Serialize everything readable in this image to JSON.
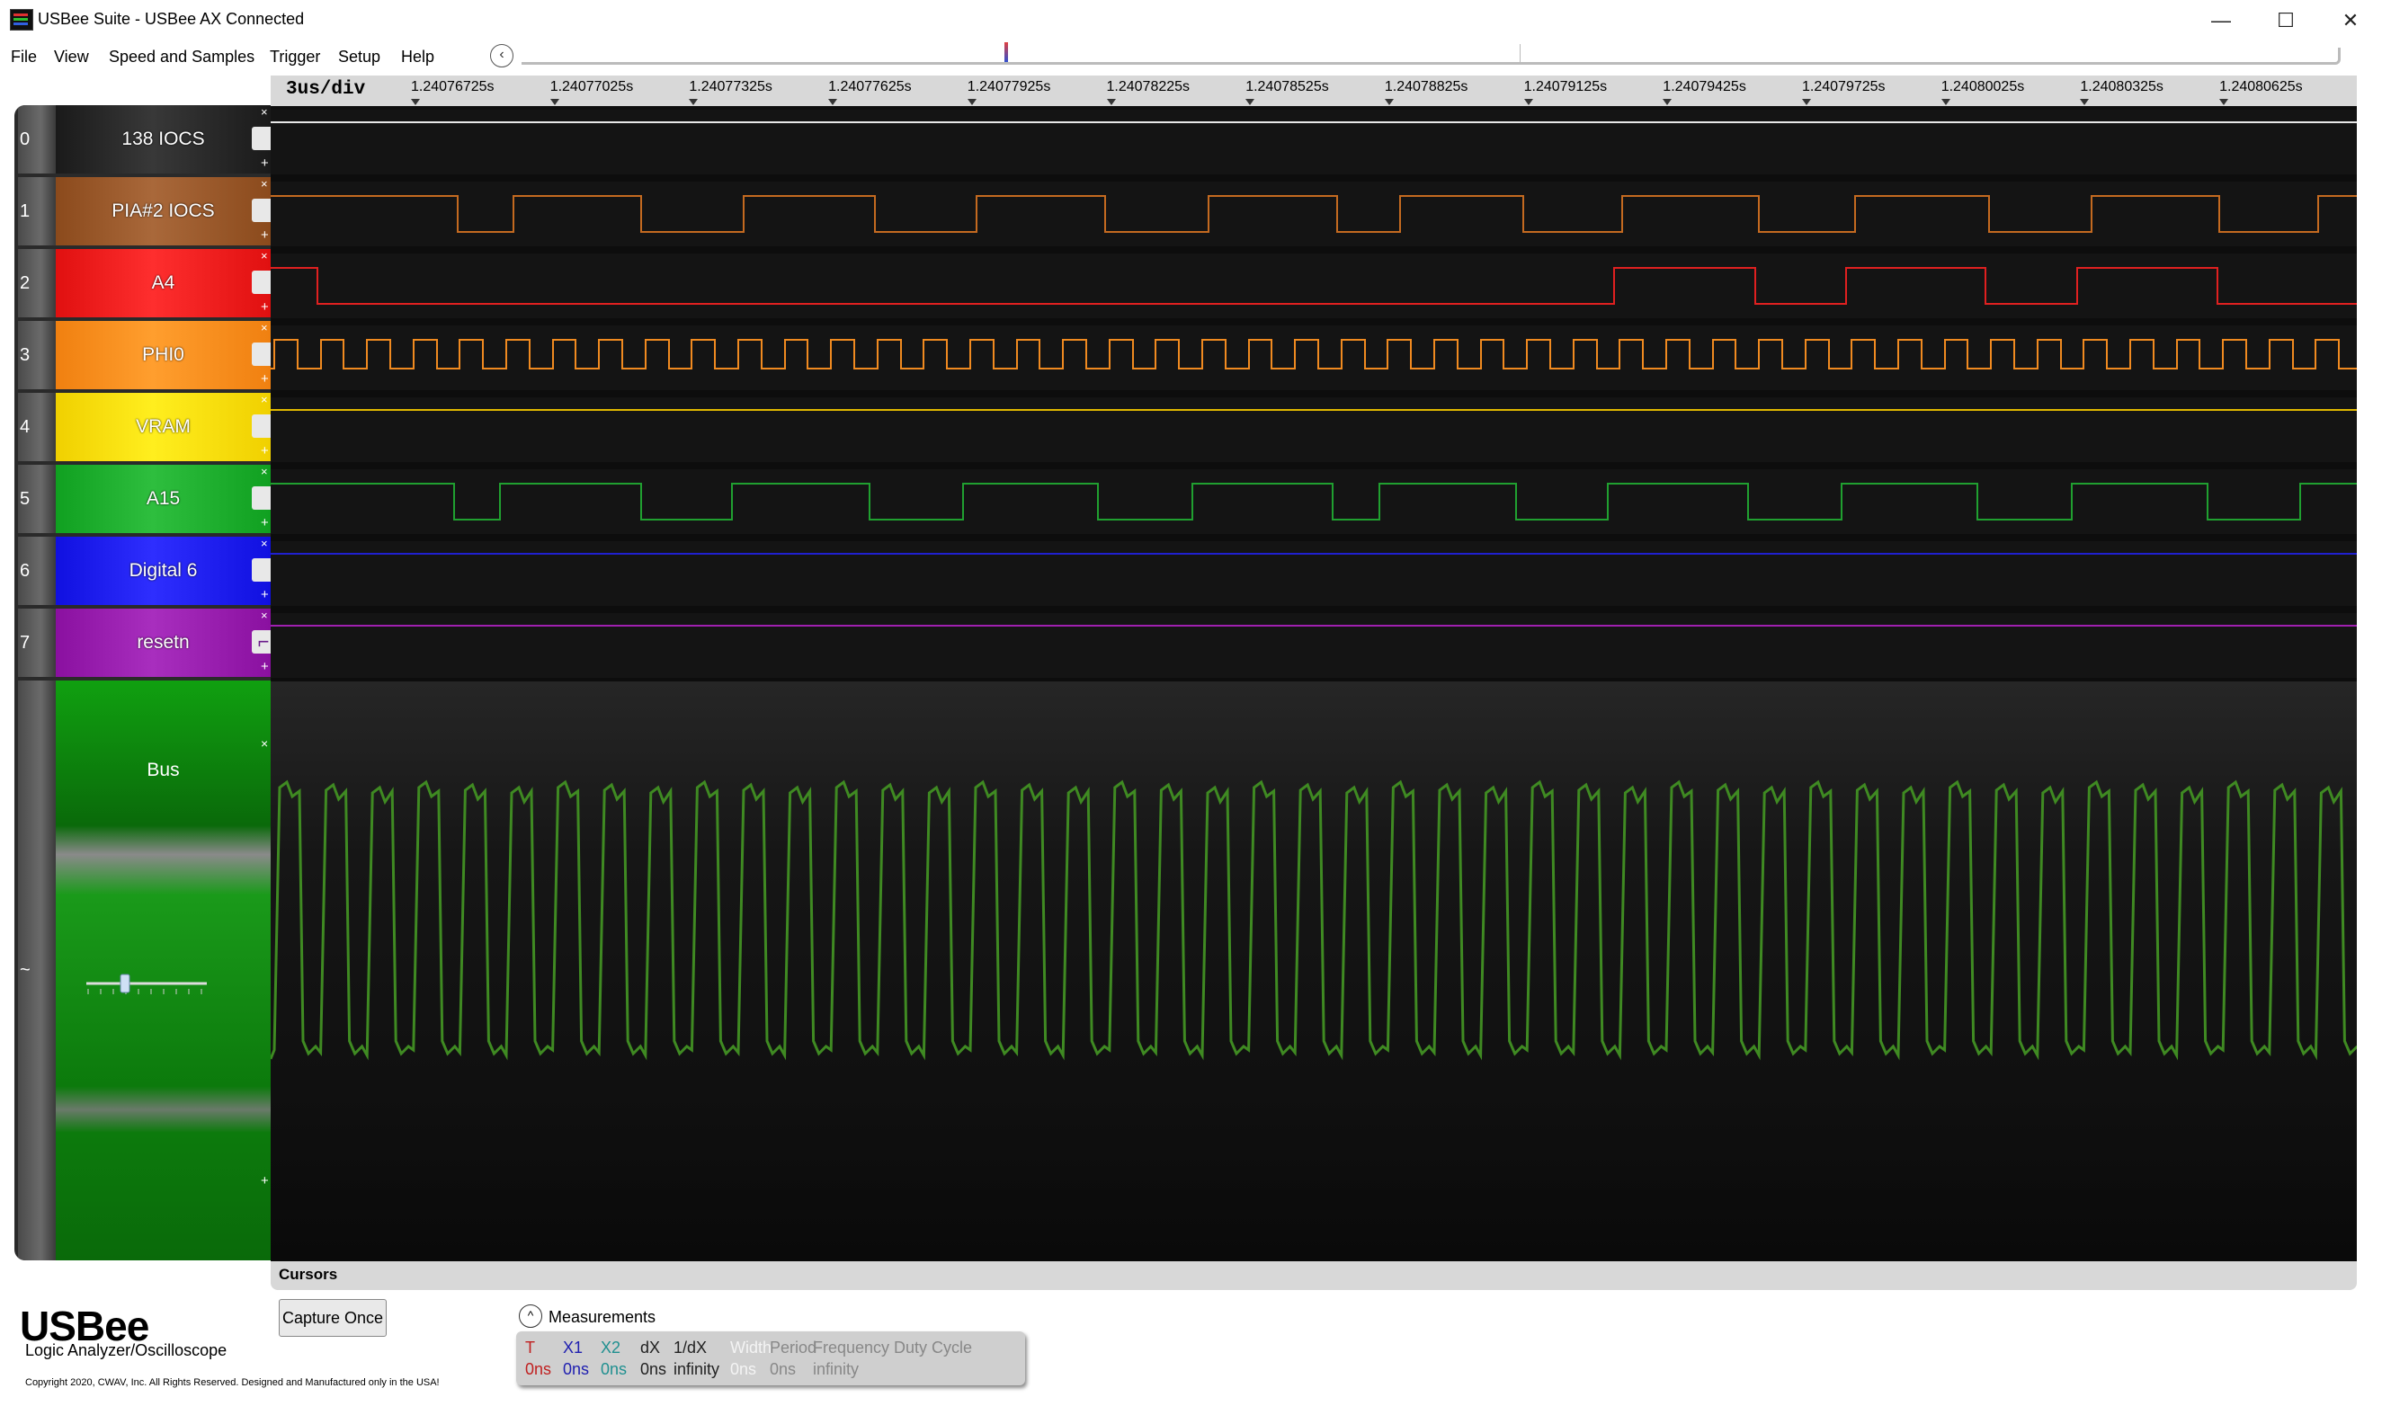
{
  "window": {
    "title": "USBee Suite - USBee AX Connected",
    "controls": [
      "—",
      "☐",
      "✕"
    ]
  },
  "menu": [
    "File",
    "View",
    "Speed and Samples",
    "Trigger",
    "Setup",
    "Help"
  ],
  "toolbar": {
    "scroll_back_icon": "chevron-left-icon"
  },
  "ruler": {
    "scale": "3us/div",
    "ticks": [
      "1.24076725s",
      "1.24077025s",
      "1.24077325s",
      "1.24077625s",
      "1.24077925s",
      "1.24078225s",
      "1.24078525s",
      "1.24078825s",
      "1.24079125s",
      "1.24079425s",
      "1.24079725s",
      "1.24080025s",
      "1.24080325s",
      "1.24080625s"
    ]
  },
  "channels": [
    {
      "num": "0",
      "name": "138 IOCS",
      "color": "#1a1a1a"
    },
    {
      "num": "1",
      "name": "PIA#2 IOCS",
      "color": "#8b4a1c"
    },
    {
      "num": "2",
      "name": "A4",
      "color": "#e01010"
    },
    {
      "num": "3",
      "name": "PHI0",
      "color": "#f08010"
    },
    {
      "num": "4",
      "name": "VRAM",
      "color": "#f0d000"
    },
    {
      "num": "5",
      "name": "A15",
      "color": "#10a020"
    },
    {
      "num": "6",
      "name": "Digital 6",
      "color": "#1010e0"
    },
    {
      "num": "7",
      "name": "resetn",
      "color": "#8a10a0",
      "trigger_glyph": "⌐"
    }
  ],
  "bus": {
    "name": "Bus",
    "num": "~",
    "color": "#129212"
  },
  "channel_controls": {
    "remove": "×",
    "add": "+"
  },
  "bottom": {
    "cursors_label": "Cursors",
    "logo": "USBee",
    "logo_sub": "Logic Analyzer/Oscilloscope",
    "copyright": "Copyright 2020, CWAV, Inc. All Rights Reserved. Designed and Manufactured only in the USA!",
    "capture_button": "Capture Once",
    "measurements_label": "Measurements",
    "measurements_toggle": "^",
    "measurements": [
      {
        "label": "T",
        "value": "0ns",
        "color": "#c02020"
      },
      {
        "label": "X1",
        "value": "0ns",
        "color": "#2020b0"
      },
      {
        "label": "X2",
        "value": "0ns",
        "color": "#209090"
      },
      {
        "label": "dX",
        "value": "0ns",
        "color": "#222222"
      },
      {
        "label": "1/dX",
        "value": "infinity",
        "color": "#222222"
      },
      {
        "label": "Width",
        "value": "0ns",
        "color": "#f4f4f4"
      },
      {
        "label": "Period",
        "value": "0ns",
        "color": "#888888"
      },
      {
        "label": "Frequency",
        "value": "infinity",
        "color": "#888888"
      },
      {
        "label": "Duty Cycle",
        "value": "",
        "color": "#888888"
      }
    ]
  }
}
